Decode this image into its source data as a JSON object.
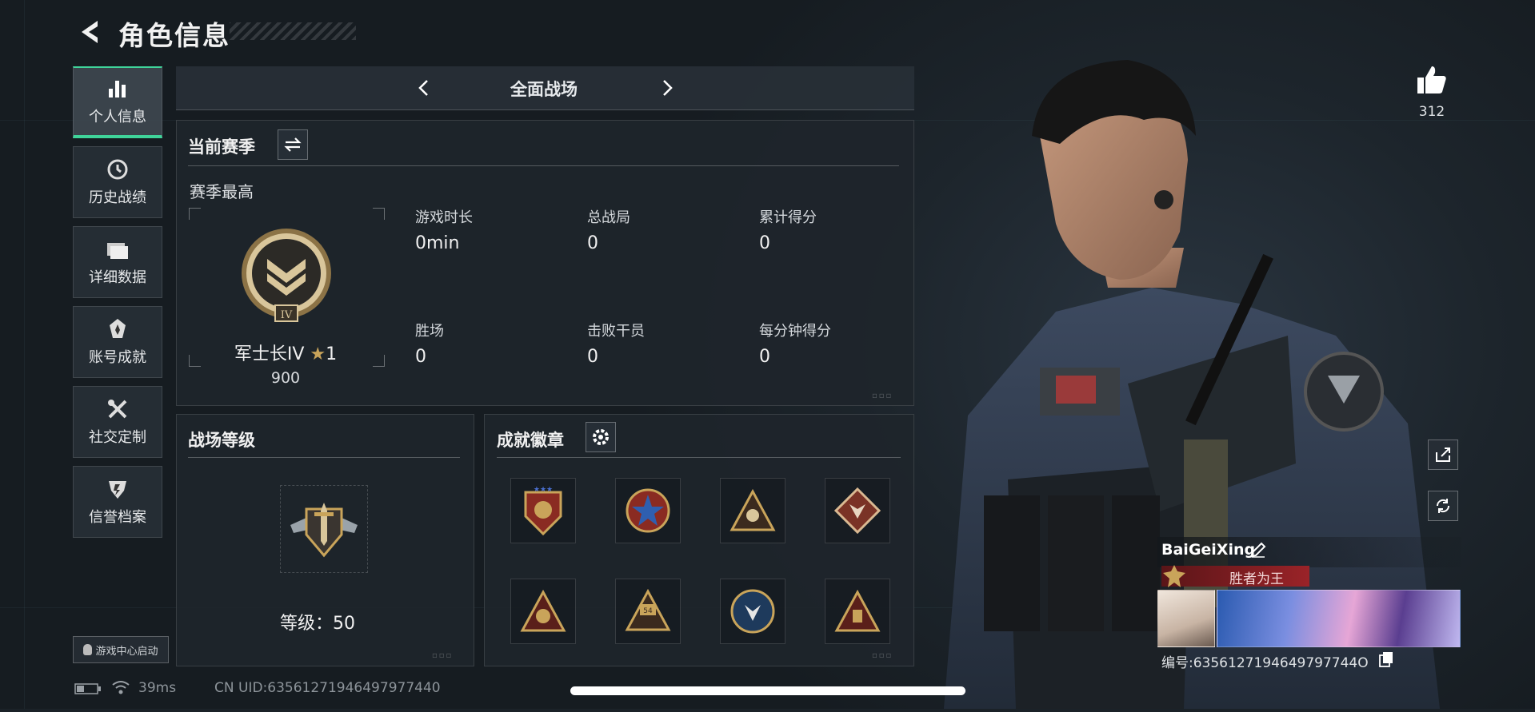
{
  "header": {
    "title": "角色信息"
  },
  "nav": {
    "items": [
      {
        "label": "个人信息",
        "icon": "bar-chart-icon"
      },
      {
        "label": "历史战绩",
        "icon": "clock-icon"
      },
      {
        "label": "详细数据",
        "icon": "folder-icon"
      },
      {
        "label": "账号成就",
        "icon": "achievement-icon"
      },
      {
        "label": "社交定制",
        "icon": "tools-icon"
      },
      {
        "label": "信誉档案",
        "icon": "credit-icon"
      }
    ],
    "game_center": "游戏中心启动"
  },
  "mode_selector": {
    "label": "全面战场"
  },
  "season": {
    "title": "当前赛季",
    "subtitle": "赛季最高",
    "rank_name": "军士长IV",
    "rank_stars": "1",
    "rank_points": "900",
    "rank_badge_numeral": "IV",
    "stats": [
      {
        "label": "游戏时长",
        "value": "0min"
      },
      {
        "label": "总战局",
        "value": "0"
      },
      {
        "label": "累计得分",
        "value": "0"
      },
      {
        "label": "胜场",
        "value": "0"
      },
      {
        "label": "击败干员",
        "value": "0"
      },
      {
        "label": "每分钟得分",
        "value": "0"
      }
    ]
  },
  "battlefield_level": {
    "title": "战场等级",
    "level_label": "等级：",
    "level_value": "50"
  },
  "achievements": {
    "title": "成就徽章",
    "badge_54": "54"
  },
  "profile": {
    "likes": "312",
    "player_name": "BaiGeiXing",
    "player_title": "胜者为王",
    "id_label": "编号:",
    "id_value": "6356127194649797744O"
  },
  "status_bar": {
    "ping": "39ms",
    "uid_label": "CN UID:",
    "uid_value": "63561271946497977440"
  },
  "colors": {
    "accent": "#3fd49a",
    "gold": "#c9a45a",
    "title_red": "#8a1f24"
  }
}
